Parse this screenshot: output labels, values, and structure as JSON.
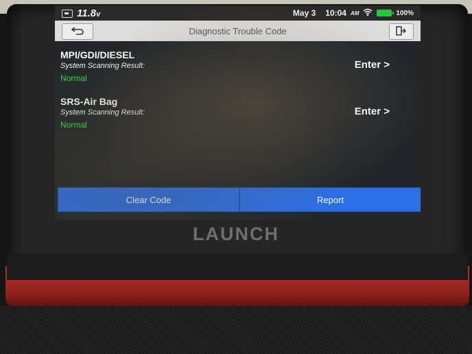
{
  "status_bar": {
    "voltage": "11.8",
    "voltage_unit": "v",
    "date": "May 3",
    "time": "10:04",
    "ampm": "AM",
    "battery": "100%"
  },
  "header": {
    "title": "Diagnostic Trouble Code",
    "back_icon": "back-arrow-icon",
    "exit_icon": "exit-icon"
  },
  "systems": [
    {
      "name": "MPI/GDI/DIESEL",
      "scan_label": "System Scanning Result:",
      "result": "Normal",
      "enter": "Enter >"
    },
    {
      "name": "SRS-Air Bag",
      "scan_label": "System Scanning Result:",
      "result": "Normal",
      "enter": "Enter >"
    }
  ],
  "footer": {
    "clear_code": "Clear Code",
    "report": "Report"
  },
  "brand": "LAUNCH",
  "colors": {
    "accent": "#2d6fe6",
    "normal_status": "#37e24a",
    "case_red": "#b8332d"
  }
}
